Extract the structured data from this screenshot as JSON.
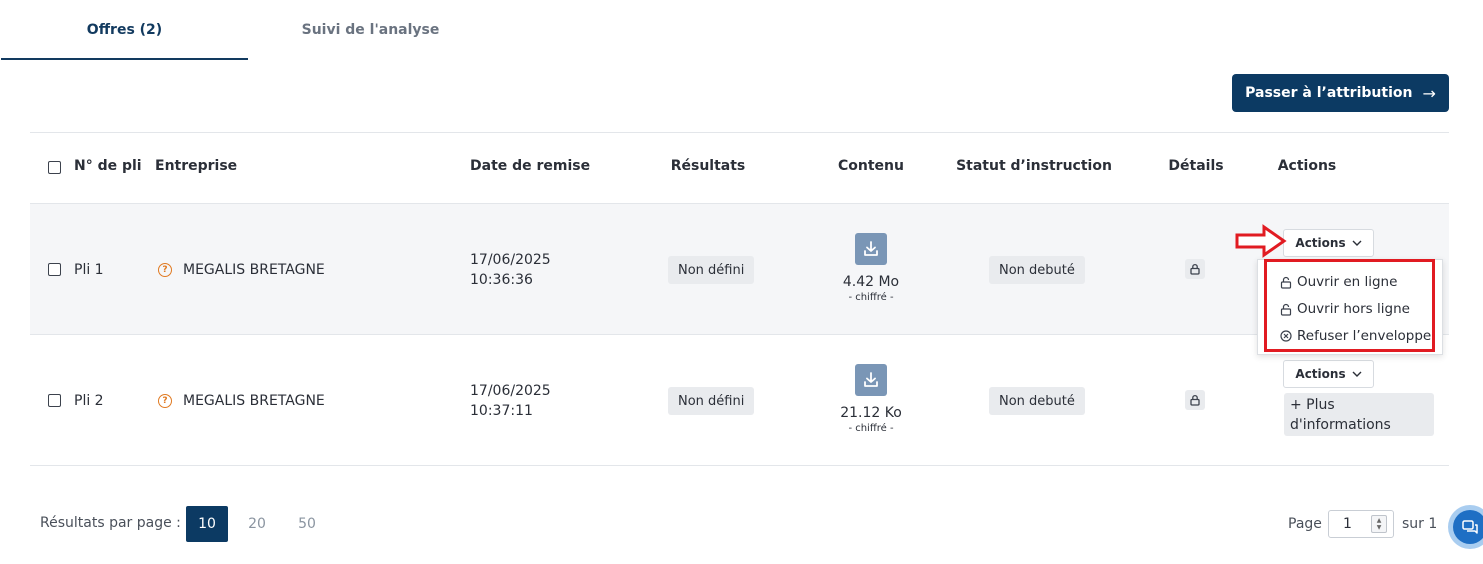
{
  "tabs": [
    {
      "label": "Offres (2)",
      "active": true
    },
    {
      "label": "Suivi de l'analyse",
      "active": false
    }
  ],
  "primary_button": {
    "label": "Passer à l’attribution",
    "icon": "arrow-right-icon"
  },
  "table": {
    "columns": [
      "N° de pli",
      "Entreprise",
      "Date de remise",
      "Résultats",
      "Contenu",
      "Statut d’instruction",
      "Détails",
      "Actions"
    ],
    "rows": [
      {
        "pli": "Pli 1",
        "entreprise": "MEGALIS BRETAGNE",
        "date": "17/06/2025",
        "time": "10:36:36",
        "resultat": "Non défini",
        "size": "4.42 Mo",
        "chiffre": "- chiffré -",
        "statut": "Non debuté",
        "actions_label": "Actions"
      },
      {
        "pli": "Pli 2",
        "entreprise": "MEGALIS BRETAGNE",
        "date": "17/06/2025",
        "time": "10:37:11",
        "resultat": "Non défini",
        "size": "21.12 Ko",
        "chiffre": "- chiffré -",
        "statut": "Non debuté",
        "actions_label": "Actions",
        "more_info": "+ Plus d'informations"
      }
    ]
  },
  "actions_menu": {
    "items": [
      {
        "label": "Ouvrir en ligne",
        "icon": "unlock-icon"
      },
      {
        "label": "Ouvrir hors ligne",
        "icon": "unlock-icon"
      },
      {
        "label": "Refuser l’enveloppe",
        "icon": "circle-x-icon"
      }
    ]
  },
  "pagination": {
    "per_page_label": "Résultats par page :",
    "options": [
      "10",
      "20",
      "50"
    ],
    "selected": "10",
    "page_label": "Page",
    "current_page": "1",
    "total_label": "sur 1"
  },
  "colors": {
    "primary": "#0c3a63",
    "warning": "#e07a22",
    "highlight": "#e11b22",
    "download": "#7a96b6"
  }
}
